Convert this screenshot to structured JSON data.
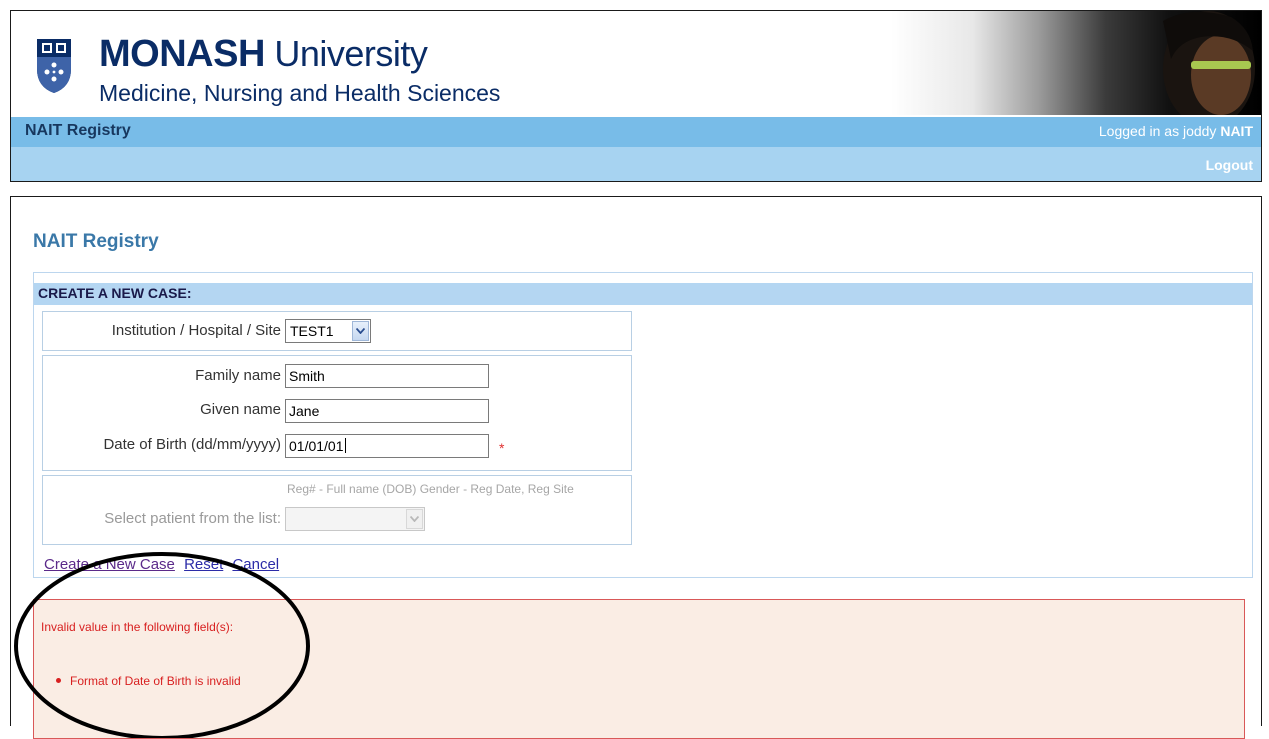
{
  "header": {
    "brand_name_bold": "MONASH",
    "brand_name_rest": " University",
    "brand_subtitle": "Medicine, Nursing and Health Sciences",
    "nav_title": "NAIT Registry",
    "logged_in_prefix": "Logged in as joddy ",
    "logged_in_org": "NAIT",
    "logout_label": "Logout"
  },
  "page": {
    "title": "NAIT Registry"
  },
  "form": {
    "heading": "CREATE A NEW CASE:",
    "site_label": "Institution / Hospital / Site",
    "site_value": "TEST1",
    "family_label": "Family name",
    "family_value": "Smith",
    "given_label": "Given name",
    "given_value": "Jane",
    "dob_label": "Date of Birth (dd/mm/yyyy)",
    "dob_value": "01/01/01",
    "required_mark": "*",
    "patient_hint": "Reg# - Full name (DOB) Gender - Reg Date, Reg Site",
    "patient_label": "Select patient from the list:",
    "patient_value": ""
  },
  "actions": {
    "create_label": "Create a New Case",
    "reset_label": "Reset",
    "cancel_label": "Cancel"
  },
  "error": {
    "title": "Invalid value in the following field(s):",
    "items": [
      "Format of Date of Birth is invalid"
    ]
  },
  "colors": {
    "nav_band": "#78bce8",
    "sub_band": "#a7d3f1",
    "form_head": "#b4d6f2",
    "brand_blue": "#0a2c66",
    "error_red": "#d82020",
    "error_bg": "#faede4"
  }
}
